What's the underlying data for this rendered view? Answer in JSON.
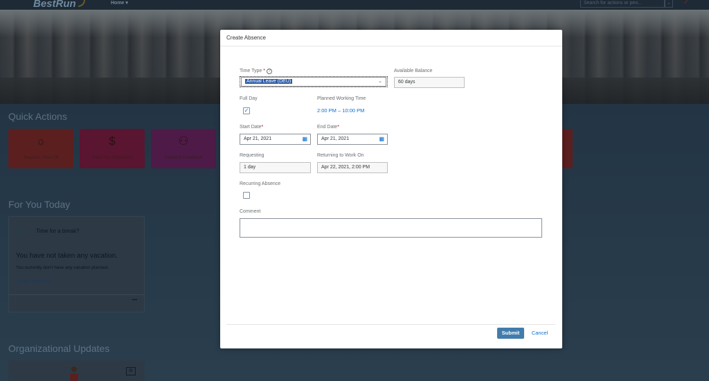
{
  "app": {
    "logo": "BestRun",
    "home_menu": "Home ▾",
    "search_placeholder": "Search for actions or peo...",
    "search_dropdown": "⌄"
  },
  "quick_actions": {
    "title": "Quick Actions",
    "tiles": [
      {
        "label": "Request Time Off",
        "icon": "sun-relax-icon",
        "color": "#5c1f20"
      },
      {
        "label": "View Pay Statement",
        "icon": "dollar-doc-icon",
        "color": "#5a1530"
      },
      {
        "label": "Request Feedback",
        "icon": "people-feedback-icon",
        "color": "#4e1a48"
      }
    ]
  },
  "for_you_today": {
    "title": "For You Today",
    "card_title": "Time for a break?",
    "main_text": "You have not taken any vacation.",
    "sub_text": "You currently don't have any vacation planned.",
    "link": "Create Absence",
    "more": "•••"
  },
  "org_updates": {
    "title": "Organizational Updates"
  },
  "dialog": {
    "title": "Create Absence",
    "time_type": {
      "label": "Time Type",
      "required": "*",
      "value": "Annual Leave (DEU)",
      "arrow": "⌄"
    },
    "available_balance": {
      "label": "Available Balance",
      "value": "60 days"
    },
    "full_day": {
      "label": "Full Day",
      "checked": "✓"
    },
    "planned_working_time": {
      "label": "Planned Working Time",
      "value": "2:00 PM – 10:00 PM"
    },
    "start_date": {
      "label": "Start Date",
      "required": "*",
      "value": "Apr 21, 2021"
    },
    "end_date": {
      "label": "End Date",
      "required": "*",
      "value": "Apr 21, 2021"
    },
    "requesting": {
      "label": "Requesting",
      "value": "1 day"
    },
    "returning": {
      "label": "Returning to Work On",
      "value": "Apr 22, 2021, 2:00 PM"
    },
    "recurring": {
      "label": "Recurring Absence"
    },
    "comment": {
      "label": "Comment",
      "value": ""
    },
    "submit_label": "Submit",
    "cancel_label": "Cancel"
  },
  "colors": {
    "accent": "#0a6ed1",
    "submit": "#427cac",
    "required": "#bb0000"
  }
}
